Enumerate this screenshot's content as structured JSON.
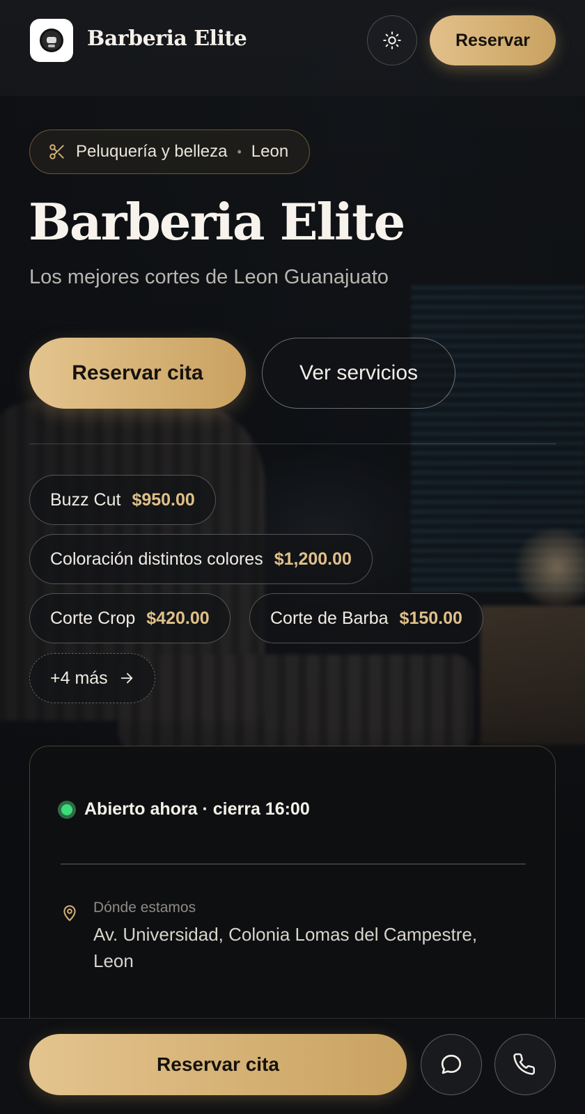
{
  "header": {
    "brand": "Barberia Elite",
    "reserve_label": "Reservar"
  },
  "hero": {
    "category": "Peluquería y belleza",
    "city": "Leon",
    "title": "Barberia Elite",
    "subtitle": "Los mejores cortes de Leon Guanajuato",
    "primary_cta": "Reservar cita",
    "secondary_cta": "Ver servicios"
  },
  "services": [
    {
      "name": "Buzz Cut",
      "price": "$950.00"
    },
    {
      "name": "Coloración distintos colores",
      "price": "$1,200.00"
    },
    {
      "name": "Corte Crop",
      "price": "$420.00"
    },
    {
      "name": "Corte de Barba",
      "price": "$150.00"
    }
  ],
  "more_services": "+4 más",
  "info": {
    "status": "Abierto ahora · cierra 16:00",
    "location_label": "Dónde estamos",
    "address": "Av. Universidad, Colonia Lomas del Campestre, Leon"
  },
  "bottom_bar": {
    "cta": "Reservar cita"
  },
  "icons": {
    "theme": "sun-icon",
    "category": "scissors-icon",
    "more": "arrow-right-icon",
    "location": "map-pin-icon",
    "chat": "chat-bubble-icon",
    "phone": "phone-icon"
  },
  "colors": {
    "accent_gold": "#d4b077",
    "status_green": "#3ddc7a",
    "background": "#0d0f12"
  }
}
